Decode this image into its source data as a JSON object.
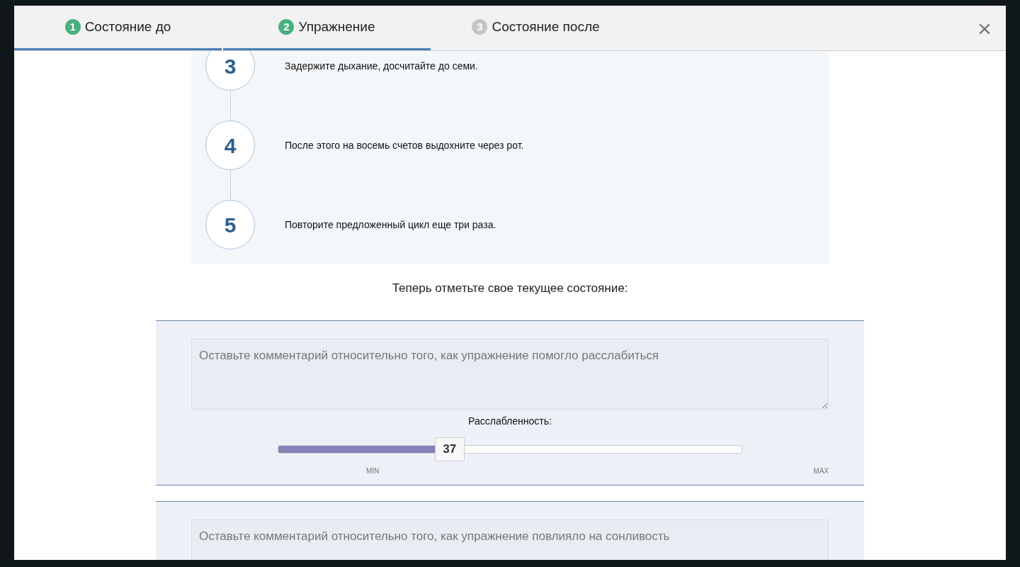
{
  "tabs": [
    {
      "number": "1",
      "label": "Состояние до",
      "reached": true
    },
    {
      "number": "2",
      "label": "Упражнение",
      "reached": true
    },
    {
      "number": "3",
      "label": "Состояние после",
      "reached": false
    }
  ],
  "close": "×",
  "steps": [
    {
      "number": "3",
      "text": "Задержите дыхание, досчитайте до семи."
    },
    {
      "number": "4",
      "text": "После этого на восемь счетов выдохните через рот."
    },
    {
      "number": "5",
      "text": "Повторите предложенный цикл еще три раза."
    }
  ],
  "prompt": "Теперь отметьте свое текущее состояние:",
  "sections": [
    {
      "placeholder": "Оставьте комментарий относительно того, как упражнение помогло расслабиться",
      "slider": {
        "label": "Расслабленность:",
        "value": "37",
        "level": 0.37,
        "min": "MIN",
        "max": "MAX"
      }
    },
    {
      "placeholder": "Оставьте комментарий относительно того, как упражнение повлияло на сонливость"
    }
  ]
}
